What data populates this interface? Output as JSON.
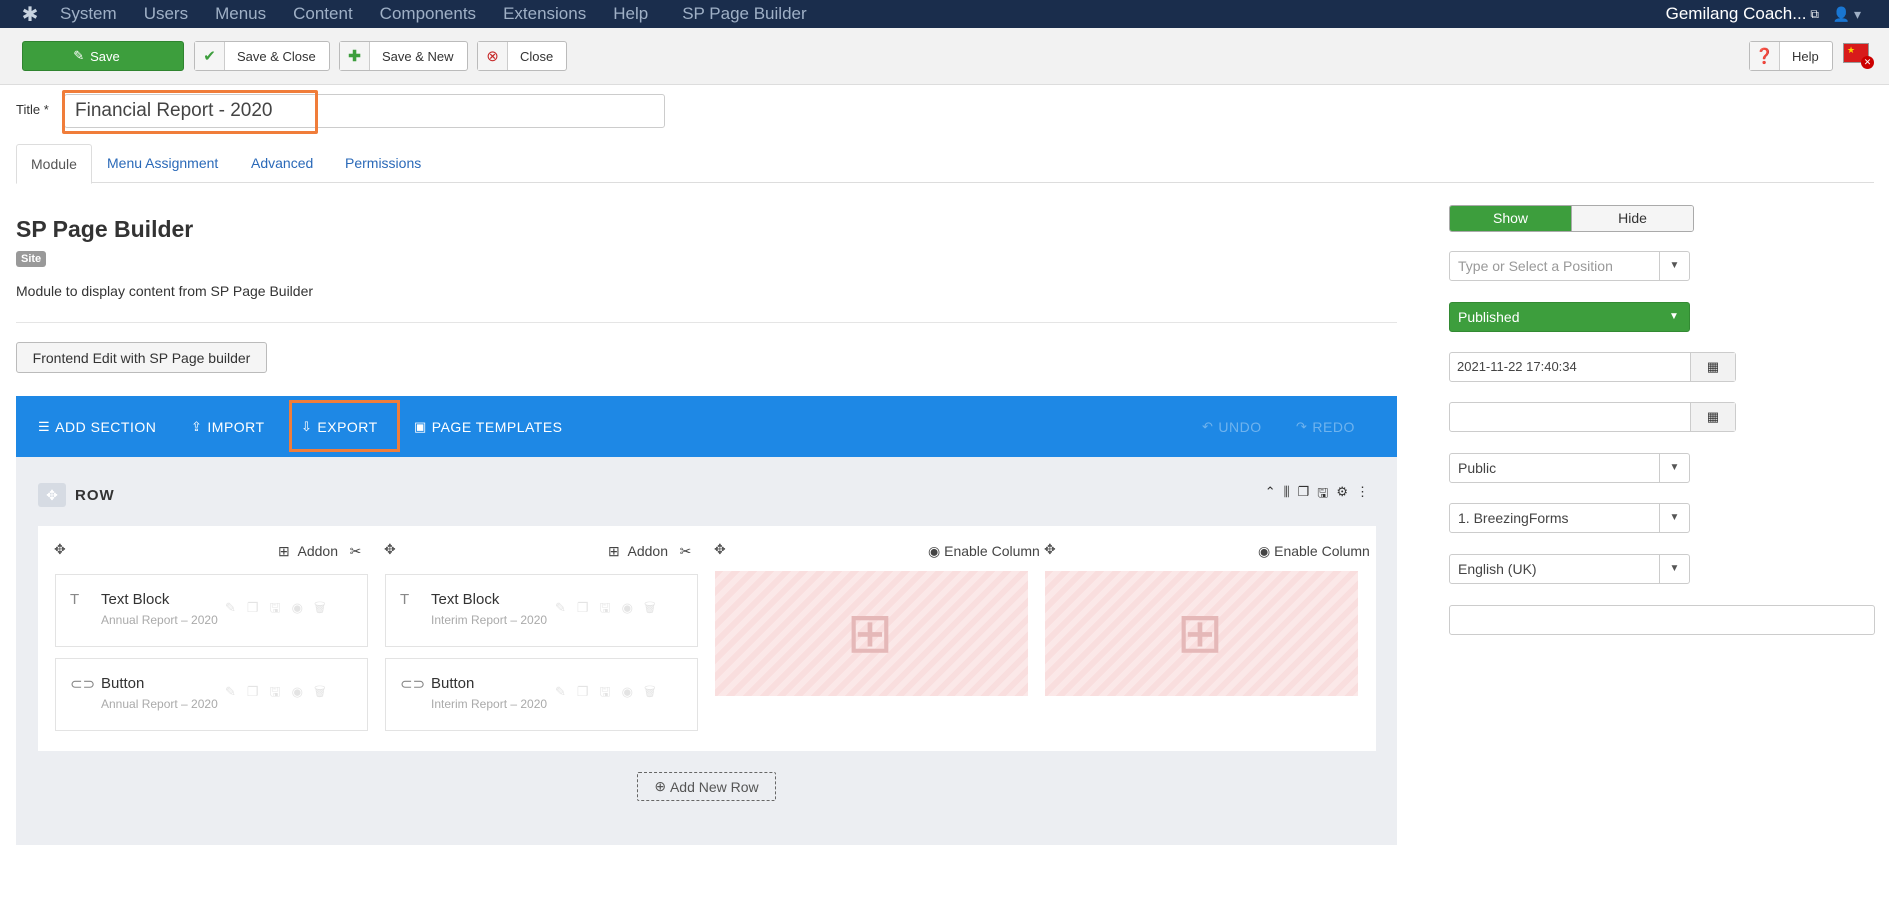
{
  "topnav": {
    "logo_icon": "joomla-icon",
    "items": [
      "System",
      "Users",
      "Menus",
      "Content",
      "Components",
      "Extensions",
      "Help"
    ],
    "component": "SP Page Builder",
    "site_name": "Gemilang Coach...",
    "user_icon": "user-icon"
  },
  "toolbar": {
    "save": "Save",
    "save_close": "Save & Close",
    "save_new": "Save & New",
    "close": "Close",
    "help": "Help"
  },
  "title_field": {
    "label": "Title *",
    "value": "Financial Report - 2020"
  },
  "tabs": [
    "Module",
    "Menu Assignment",
    "Advanced",
    "Permissions"
  ],
  "module": {
    "title": "SP Page Builder",
    "badge": "Site",
    "description": "Module to display content from SP Page Builder",
    "frontend_button": "Frontend Edit with SP Page builder"
  },
  "builder_bar": {
    "add_section": "ADD SECTION",
    "import": "IMPORT",
    "export": "EXPORT",
    "page_templates": "PAGE TEMPLATES",
    "undo": "UNDO",
    "redo": "REDO"
  },
  "row": {
    "label": "ROW",
    "columns": [
      {
        "header": "Addon",
        "addons": [
          {
            "name": "Text Block",
            "sub": "Annual Report – 2020",
            "icon": "text-block-icon"
          },
          {
            "name": "Button",
            "sub": "Annual Report – 2020",
            "icon": "button-icon"
          }
        ]
      },
      {
        "header": "Addon",
        "addons": [
          {
            "name": "Text Block",
            "sub": "Interim Report – 2020",
            "icon": "text-block-icon"
          },
          {
            "name": "Button",
            "sub": "Interim Report – 2020",
            "icon": "button-icon"
          }
        ]
      },
      {
        "header": "Enable Column"
      },
      {
        "header": "Enable Column"
      }
    ],
    "add_new_row": "Add New Row"
  },
  "side": {
    "show": "Show",
    "hide": "Hide",
    "position_placeholder": "Type or Select a Position",
    "status": "Published",
    "publish_up": "2021-11-22 17:40:34",
    "publish_down": "",
    "access": "Public",
    "ordering": "1. BreezingForms",
    "language": "English (UK)",
    "note": ""
  },
  "colors": {
    "accent_green": "#3d9e3d",
    "builder_blue": "#1e88e5",
    "highlight_orange": "#f07d3a",
    "nav_dark": "#1a2d4c"
  }
}
